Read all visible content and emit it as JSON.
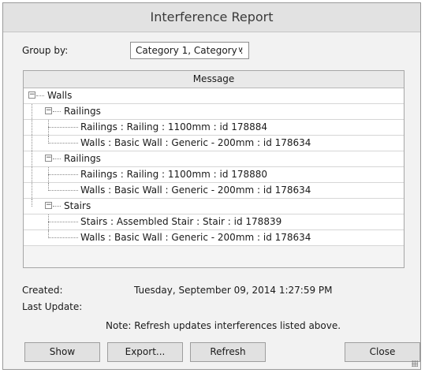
{
  "window": {
    "title": "Interference Report"
  },
  "group_by": {
    "label": "Group by:",
    "value": "Category 1, Category :"
  },
  "table": {
    "header": "Message",
    "root": "Walls",
    "groups": [
      {
        "label": "Railings",
        "items": [
          "Railings : Railing : 1100mm : id 178884",
          "Walls : Basic Wall : Generic - 200mm : id 178634"
        ]
      },
      {
        "label": "Railings",
        "items": [
          "Railings : Railing : 1100mm : id 178880",
          "Walls : Basic Wall : Generic - 200mm : id 178634"
        ]
      },
      {
        "label": "Stairs",
        "items": [
          "Stairs : Assembled Stair : Stair : id 178839",
          "Walls : Basic Wall : Generic - 200mm : id 178634"
        ]
      }
    ]
  },
  "info": {
    "created_label": "Created:",
    "created_value": "Tuesday, September 09, 2014 1:27:59 PM",
    "last_update_label": "Last Update:",
    "note": "Note: Refresh updates interferences listed above."
  },
  "buttons": {
    "show": "Show",
    "export": "Export...",
    "refresh": "Refresh",
    "close": "Close"
  }
}
